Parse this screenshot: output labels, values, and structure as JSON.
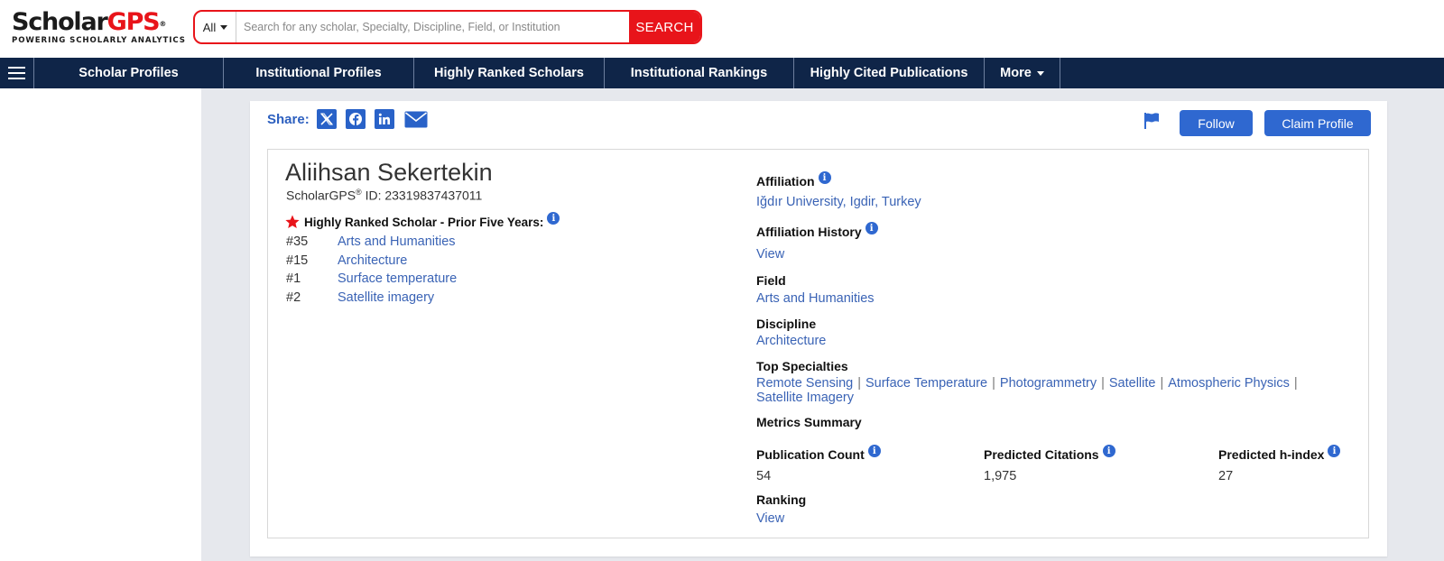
{
  "logo": {
    "scholar": "Scholar",
    "gps": "GPS",
    "reg": "®",
    "tagline": "POWERING SCHOLARLY ANALYTICS"
  },
  "search": {
    "scope": "All",
    "placeholder": "Search for any scholar, Specialty, Discipline, Field, or Institution",
    "value": "",
    "button": "SEARCH"
  },
  "nav": {
    "items": [
      "Scholar Profiles",
      "Institutional Profiles",
      "Highly Ranked Scholars",
      "Institutional Rankings",
      "Highly Cited Publications"
    ],
    "more": "More"
  },
  "share": {
    "label": "Share:"
  },
  "actions": {
    "follow": "Follow",
    "claim": "Claim Profile"
  },
  "profile": {
    "name": "Aliihsan Sekertekin",
    "id_prefix": "ScholarGPS",
    "id_reg": "®",
    "id_suffix": " ID: 23319837437011",
    "highly_ranked_title": "Highly Ranked Scholar - Prior Five Years:",
    "rankings": [
      {
        "rank": "#35",
        "label": "Arts and Humanities"
      },
      {
        "rank": "#15",
        "label": "Architecture"
      },
      {
        "rank": "#1",
        "label": "Surface temperature"
      },
      {
        "rank": "#2",
        "label": "Satellite imagery"
      }
    ]
  },
  "details": {
    "affiliation_label": "Affiliation",
    "affiliation_value": "Iğdır University, Igdir, Turkey",
    "affiliation_history_label": "Affiliation History",
    "affiliation_history_link": "View",
    "field_label": "Field",
    "field_value": "Arts and Humanities",
    "discipline_label": "Discipline",
    "discipline_value": "Architecture",
    "top_specialties_label": "Top Specialties",
    "specialties": [
      "Remote Sensing",
      "Surface Temperature",
      "Photogrammetry",
      "Satellite",
      "Atmospheric Physics",
      "Satellite Imagery"
    ],
    "metrics_summary_label": "Metrics Summary",
    "metrics": [
      {
        "label": "Publication Count",
        "value": "54"
      },
      {
        "label": "Predicted Citations",
        "value": "1,975"
      },
      {
        "label": "Predicted h-index",
        "value": "27"
      }
    ],
    "ranking_label": "Ranking",
    "ranking_link": "View"
  },
  "colors": {
    "brand_red": "#e8141a",
    "nav_bg": "#0f2548",
    "link": "#3a63b5",
    "button": "#2f68d0"
  },
  "icons": {
    "star": "star-icon",
    "info": "info-icon",
    "flag": "flag-icon",
    "x": "x-icon",
    "facebook": "facebook-icon",
    "linkedin": "linkedin-icon",
    "mail": "mail-icon"
  }
}
